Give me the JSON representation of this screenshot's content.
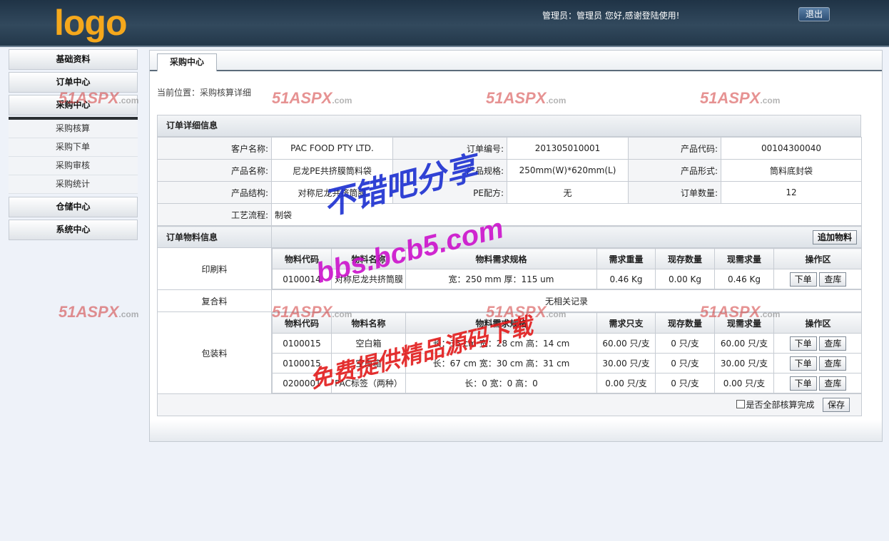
{
  "header": {
    "logo": "logo",
    "welcome": "管理员：管理员 您好,感谢登陆使用!",
    "logout": "退出"
  },
  "sidebar": {
    "items": [
      "基础资料",
      "订单中心",
      "采购中心"
    ],
    "submenu": [
      "采购核算",
      "采购下单",
      "采购审核",
      "采购统计"
    ],
    "items_after": [
      "仓储中心",
      "系统中心"
    ]
  },
  "tab": "采购中心",
  "breadcrumb": "当前位置：采购核算详细",
  "order": {
    "title": "订单详细信息",
    "customer_label": "客户名称:",
    "customer": "PAC FOOD PTY LTD.",
    "order_no_label": "订单编号:",
    "order_no": "201305010001",
    "product_code_label": "产品代码:",
    "product_code": "00104300040",
    "product_name_label": "产品名称:",
    "product_name": "尼龙PE共挤膜筒料袋",
    "spec_label": "产品规格:",
    "spec": "250mm(W)*620mm(L)",
    "form_label": "产品形式:",
    "form": "筒料底封袋",
    "structure_label": "产品结构:",
    "structure": "对称尼龙共挤筒膜",
    "pe_label": "PE配方:",
    "pe": "无",
    "qty_label": "订单数量:",
    "qty": "12",
    "process_label": "工艺流程:",
    "process": "制袋"
  },
  "materials": {
    "title": "订单物料信息",
    "add_button": "追加物料",
    "print": {
      "category": "印刷料",
      "headers": [
        "物料代码",
        "物料名称",
        "物料需求规格",
        "需求重量",
        "现存数量",
        "现需求量",
        "操作区"
      ],
      "rows": [
        {
          "code": "0100014",
          "name": "对称尼龙共挤筒膜",
          "spec": "宽：250 mm 厚：115 um",
          "need": "0.46 Kg",
          "stock": "0.00 Kg",
          "now": "0.46 Kg"
        }
      ]
    },
    "composite": {
      "category": "复合料",
      "empty": "无相关记录"
    },
    "pack": {
      "category": "包装料",
      "headers": [
        "物料代码",
        "物料名称",
        "物料需求规格",
        "需求只支",
        "现存数量",
        "现需求量",
        "操作区"
      ],
      "rows": [
        {
          "code": "0100015",
          "name": "空白箱",
          "spec": "长：35 cm 宽：28 cm 高：14 cm",
          "need": "60.00 只/支",
          "stock": "0 只/支",
          "now": "60.00 只/支"
        },
        {
          "code": "0100015",
          "name": "空白箱",
          "spec": "长：67 cm 宽：30 cm 高：31 cm",
          "need": "30.00 只/支",
          "stock": "0 只/支",
          "now": "30.00 只/支"
        },
        {
          "code": "0200001",
          "name": "PAC标签（两种）",
          "spec": "长：0 宽：0 高：0",
          "need": "0.00 只/支",
          "stock": "0 只/支",
          "now": "0.00 只/支"
        }
      ]
    },
    "order_button": "下单",
    "stock_button": "查库",
    "complete_label": "是否全部核算完成",
    "save_button": "保存"
  },
  "watermarks": {
    "aspx": "51ASPX",
    "aspx_suffix": ".com",
    "cn1": "不错吧分享",
    "url": "bbs.bcb5.com",
    "cn2": "免费提供精品源码下载"
  }
}
